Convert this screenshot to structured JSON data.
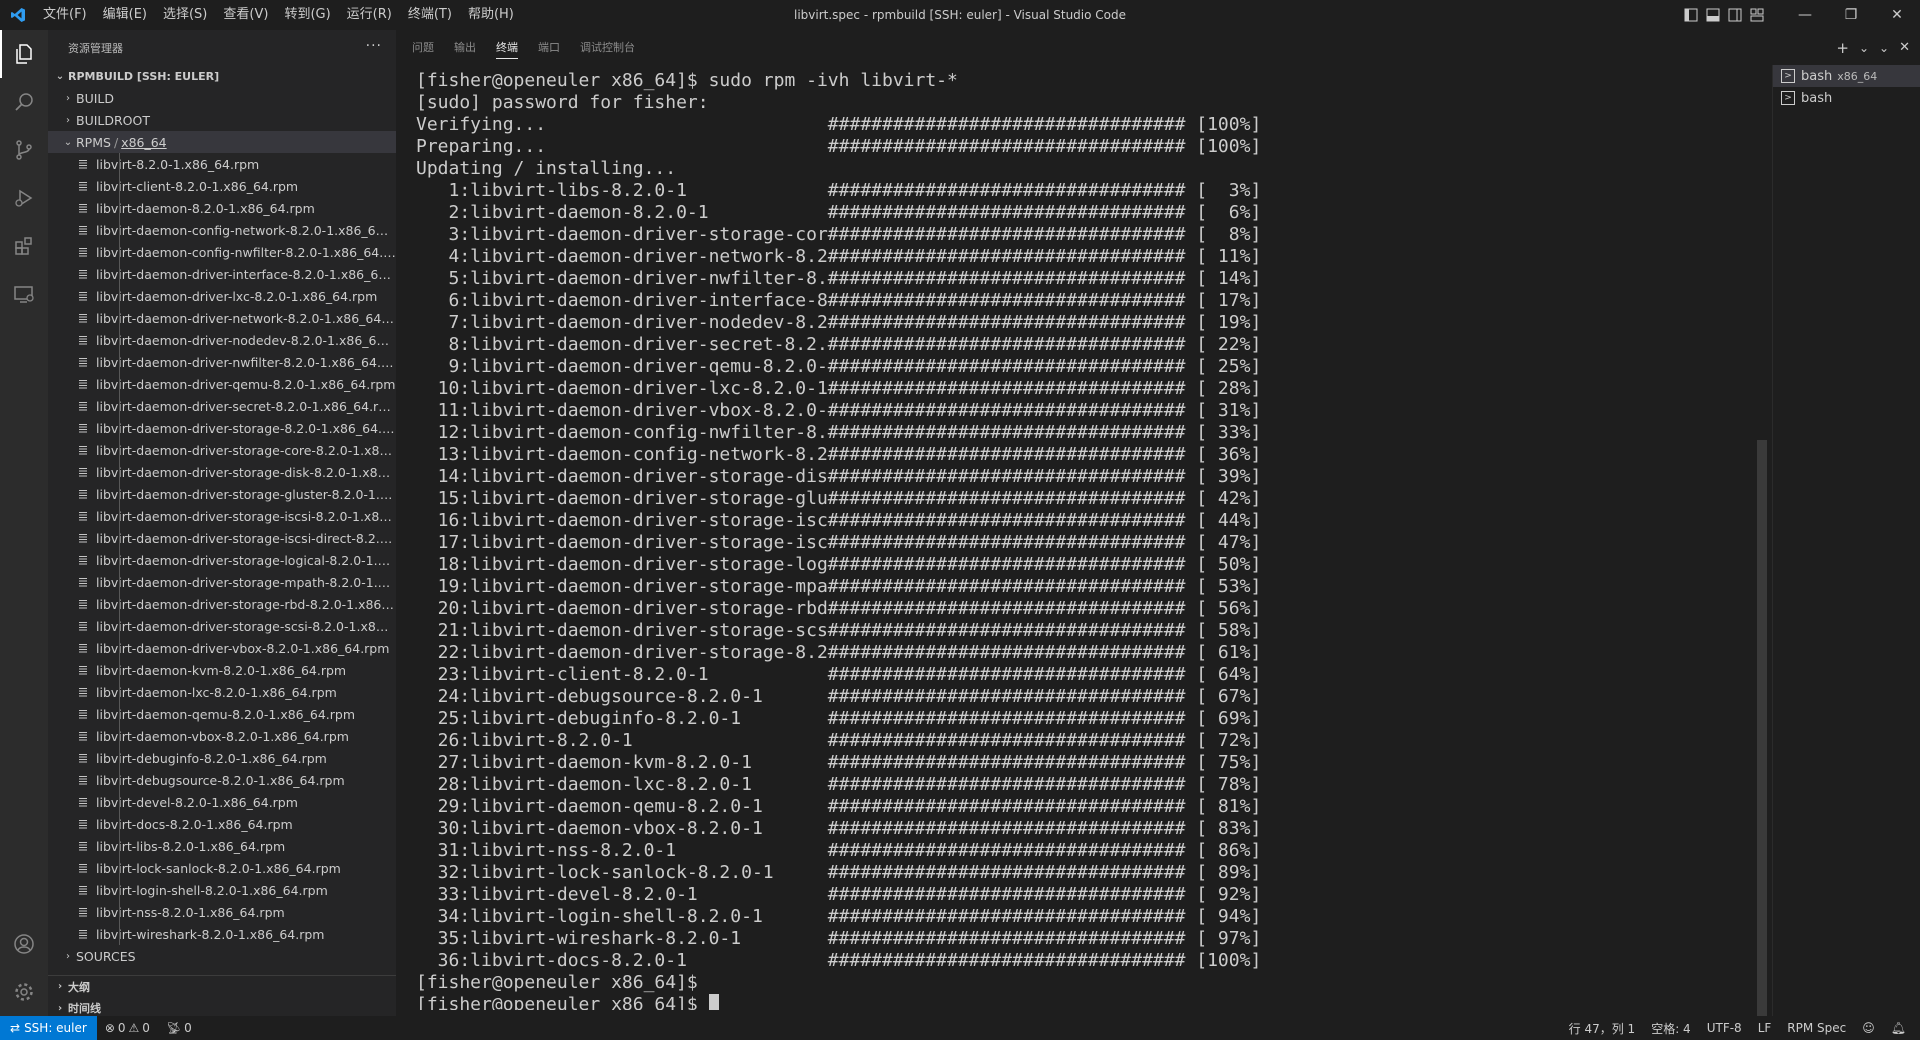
{
  "titlebar": {
    "menus": [
      "文件(F)",
      "编辑(E)",
      "选择(S)",
      "查看(V)",
      "转到(G)",
      "运行(R)",
      "终端(T)",
      "帮助(H)"
    ],
    "window_title": "libvirt.spec - rpmbuild [SSH: euler] - Visual Studio Code",
    "controls": {
      "minimize": "—",
      "restore": "❐",
      "close": "✕"
    }
  },
  "sidebar": {
    "header": "资源管理器",
    "more": "···",
    "workspace": "RPMBUILD [SSH: EULER]",
    "folders_top": [
      "BUILD",
      "BUILDROOT"
    ],
    "rpms_folder": {
      "name": "RPMS",
      "sep": "/",
      "sub": "x86_64"
    },
    "files": [
      "libvirt-8.2.0-1.x86_64.rpm",
      "libvirt-client-8.2.0-1.x86_64.rpm",
      "libvirt-daemon-8.2.0-1.x86_64.rpm",
      "libvirt-daemon-config-network-8.2.0-1.x86_64.rpm",
      "libvirt-daemon-config-nwfilter-8.2.0-1.x86_64.rpm",
      "libvirt-daemon-driver-interface-8.2.0-1.x86_64.rpm",
      "libvirt-daemon-driver-lxc-8.2.0-1.x86_64.rpm",
      "libvirt-daemon-driver-network-8.2.0-1.x86_64.rpm",
      "libvirt-daemon-driver-nodedev-8.2.0-1.x86_64.rpm",
      "libvirt-daemon-driver-nwfilter-8.2.0-1.x86_64.rpm",
      "libvirt-daemon-driver-qemu-8.2.0-1.x86_64.rpm",
      "libvirt-daemon-driver-secret-8.2.0-1.x86_64.rpm",
      "libvirt-daemon-driver-storage-8.2.0-1.x86_64.rpm",
      "libvirt-daemon-driver-storage-core-8.2.0-1.x86_64.r...",
      "libvirt-daemon-driver-storage-disk-8.2.0-1.x86_64.r...",
      "libvirt-daemon-driver-storage-gluster-8.2.0-1.x86_6...",
      "libvirt-daemon-driver-storage-iscsi-8.2.0-1.x86_64.r...",
      "libvirt-daemon-driver-storage-iscsi-direct-8.2.0-1.x...",
      "libvirt-daemon-driver-storage-logical-8.2.0-1.x86_6...",
      "libvirt-daemon-driver-storage-mpath-8.2.0-1.x86_6...",
      "libvirt-daemon-driver-storage-rbd-8.2.0-1.x86_64.r...",
      "libvirt-daemon-driver-storage-scsi-8.2.0-1.x86_64.r...",
      "libvirt-daemon-driver-vbox-8.2.0-1.x86_64.rpm",
      "libvirt-daemon-kvm-8.2.0-1.x86_64.rpm",
      "libvirt-daemon-lxc-8.2.0-1.x86_64.rpm",
      "libvirt-daemon-qemu-8.2.0-1.x86_64.rpm",
      "libvirt-daemon-vbox-8.2.0-1.x86_64.rpm",
      "libvirt-debuginfo-8.2.0-1.x86_64.rpm",
      "libvirt-debugsource-8.2.0-1.x86_64.rpm",
      "libvirt-devel-8.2.0-1.x86_64.rpm",
      "libvirt-docs-8.2.0-1.x86_64.rpm",
      "libvirt-libs-8.2.0-1.x86_64.rpm",
      "libvirt-lock-sanlock-8.2.0-1.x86_64.rpm",
      "libvirt-login-shell-8.2.0-1.x86_64.rpm",
      "libvirt-nss-8.2.0-1.x86_64.rpm",
      "libvirt-wireshark-8.2.0-1.x86_64.rpm"
    ],
    "folders_bottom": [
      "SOURCES"
    ],
    "outline": "大纲",
    "timeline": "时间线"
  },
  "panel": {
    "tabs": [
      "问题",
      "输出",
      "终端",
      "端口",
      "调试控制台"
    ],
    "active_tab": "终端",
    "actions": {
      "add": "+",
      "dropdown": "⌄",
      "collapse": "⌄",
      "close": "✕"
    },
    "terminal_lines": [
      "[fisher@openeuler x86_64]$ sudo rpm -ivh libvirt-*",
      "[sudo] password for fisher:",
      "Verifying...                          ################################# [100%]",
      "Preparing...                          ################################# [100%]",
      "Updating / installing...",
      "   1:libvirt-libs-8.2.0-1             ################################# [  3%]",
      "   2:libvirt-daemon-8.2.0-1           ################################# [  6%]",
      "   3:libvirt-daemon-driver-storage-cor################################# [  8%]",
      "   4:libvirt-daemon-driver-network-8.2################################# [ 11%]",
      "   5:libvirt-daemon-driver-nwfilter-8.################################# [ 14%]",
      "   6:libvirt-daemon-driver-interface-8################################# [ 17%]",
      "   7:libvirt-daemon-driver-nodedev-8.2################################# [ 19%]",
      "   8:libvirt-daemon-driver-secret-8.2.################################# [ 22%]",
      "   9:libvirt-daemon-driver-qemu-8.2.0-################################# [ 25%]",
      "  10:libvirt-daemon-driver-lxc-8.2.0-1################################# [ 28%]",
      "  11:libvirt-daemon-driver-vbox-8.2.0-################################# [ 31%]",
      "  12:libvirt-daemon-config-nwfilter-8.################################# [ 33%]",
      "  13:libvirt-daemon-config-network-8.2################################# [ 36%]",
      "  14:libvirt-daemon-driver-storage-dis################################# [ 39%]",
      "  15:libvirt-daemon-driver-storage-glu################################# [ 42%]",
      "  16:libvirt-daemon-driver-storage-isc################################# [ 44%]",
      "  17:libvirt-daemon-driver-storage-isc################################# [ 47%]",
      "  18:libvirt-daemon-driver-storage-log################################# [ 50%]",
      "  19:libvirt-daemon-driver-storage-mpa################################# [ 53%]",
      "  20:libvirt-daemon-driver-storage-rbd################################# [ 56%]",
      "  21:libvirt-daemon-driver-storage-scs################################# [ 58%]",
      "  22:libvirt-daemon-driver-storage-8.2################################# [ 61%]",
      "  23:libvirt-client-8.2.0-1           ################################# [ 64%]",
      "  24:libvirt-debugsource-8.2.0-1      ################################# [ 67%]",
      "  25:libvirt-debuginfo-8.2.0-1        ################################# [ 69%]",
      "  26:libvirt-8.2.0-1                  ################################# [ 72%]",
      "  27:libvirt-daemon-kvm-8.2.0-1       ################################# [ 75%]",
      "  28:libvirt-daemon-lxc-8.2.0-1       ################################# [ 78%]",
      "  29:libvirt-daemon-qemu-8.2.0-1      ################################# [ 81%]",
      "  30:libvirt-daemon-vbox-8.2.0-1      ################################# [ 83%]",
      "  31:libvirt-nss-8.2.0-1              ################################# [ 86%]",
      "  32:libvirt-lock-sanlock-8.2.0-1     ################################# [ 89%]",
      "  33:libvirt-devel-8.2.0-1            ################################# [ 92%]",
      "  34:libvirt-login-shell-8.2.0-1      ################################# [ 94%]",
      "  35:libvirt-wireshark-8.2.0-1        ################################# [ 97%]",
      "  36:libvirt-docs-8.2.0-1             ################################# [100%]",
      "[fisher@openeuler x86_64]$",
      "[fisher@openeuler x86_64]$ "
    ],
    "terminal_list": [
      {
        "name": "bash",
        "sub": "x86_64"
      },
      {
        "name": "bash",
        "sub": ""
      }
    ]
  },
  "statusbar": {
    "remote": "SSH: euler",
    "errors": "0",
    "warnings": "0",
    "ports": "0",
    "position": "行 47，列 1",
    "spaces": "空格: 4",
    "encoding": "UTF-8",
    "eol": "LF",
    "language": "RPM Spec"
  },
  "colors": {
    "accent": "#0078d4",
    "background": "#1e1e1e",
    "sidebar": "#252526",
    "activitybar": "#2c2c2c"
  }
}
